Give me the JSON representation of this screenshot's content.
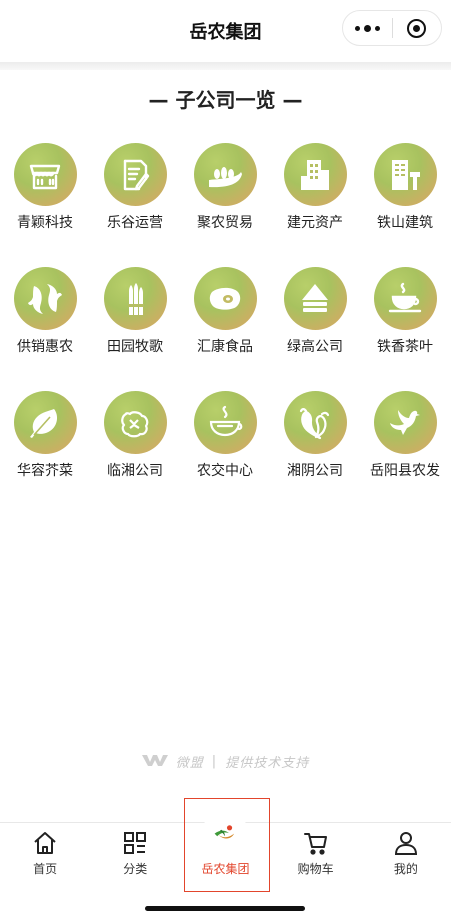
{
  "header": {
    "title": "岳农集团"
  },
  "section_title": "— 子公司一览 —",
  "companies": [
    {
      "label": "青颖科技",
      "icon": "storefront-icon"
    },
    {
      "label": "乐谷运营",
      "icon": "document-edit-icon"
    },
    {
      "label": "聚农贸易",
      "icon": "crop-bowl-icon"
    },
    {
      "label": "建元资产",
      "icon": "building-icon"
    },
    {
      "label": "铁山建筑",
      "icon": "construction-icon"
    },
    {
      "label": "供销惠农",
      "icon": "fish-icon"
    },
    {
      "label": "田园牧歌",
      "icon": "asparagus-icon"
    },
    {
      "label": "汇康食品",
      "icon": "meat-icon"
    },
    {
      "label": "绿高公司",
      "icon": "layers-icon"
    },
    {
      "label": "铁香茶叶",
      "icon": "tea-cup-icon"
    },
    {
      "label": "华容芥菜",
      "icon": "leaf-icon"
    },
    {
      "label": "临湘公司",
      "icon": "vegetable-icon"
    },
    {
      "label": "农交中心",
      "icon": "steaming-bowl-icon"
    },
    {
      "label": "湘阴公司",
      "icon": "peppers-icon"
    },
    {
      "label": "岳阳县农发",
      "icon": "dove-icon"
    }
  ],
  "support": {
    "brand": "微盟",
    "text": "提供技术支持"
  },
  "tabbar": {
    "items": [
      {
        "label": "首页",
        "icon": "home-icon"
      },
      {
        "label": "分类",
        "icon": "category-grid-icon"
      },
      {
        "label": "岳农集团",
        "icon": "brand-logo-icon"
      },
      {
        "label": "购物车",
        "icon": "cart-icon"
      },
      {
        "label": "我的",
        "icon": "user-icon"
      }
    ]
  },
  "colors": {
    "icon_gradient_start": "#a8c25f",
    "icon_gradient_end": "#d7a95e",
    "highlight": "#e2452c"
  }
}
